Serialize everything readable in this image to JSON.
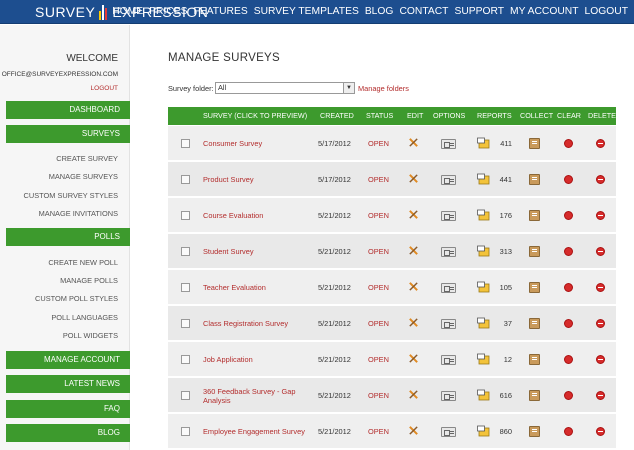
{
  "header": {
    "logo_left": "SURVEY",
    "logo_right": "EXPRESSION",
    "nav": [
      "HOME",
      "PRICES",
      "FEATURES",
      "SURVEY TEMPLATES",
      "BLOG",
      "CONTACT",
      "SUPPORT",
      "MY ACCOUNT",
      "LOGOUT"
    ]
  },
  "sidebar": {
    "welcome": "WELCOME",
    "email": "OFFICE@SURVEYEXPRESSION.COM",
    "logout": "LOGOUT",
    "dashboard": "DASHBOARD",
    "surveys": "SURVEYS",
    "survey_links": [
      "CREATE SURVEY",
      "MANAGE SURVEYS",
      "CUSTOM SURVEY STYLES",
      "MANAGE INVITATIONS"
    ],
    "polls": "POLLS",
    "poll_links": [
      "CREATE NEW POLL",
      "MANAGE POLLS",
      "CUSTOM POLL STYLES",
      "POLL LANGUAGES",
      "POLL WIDGETS"
    ],
    "manage_account": "MANAGE ACCOUNT",
    "latest_news": "LATEST NEWS",
    "faq": "FAQ",
    "blog": "BLOG"
  },
  "main": {
    "title": "MANAGE SURVEYS",
    "folder_label": "Survey folder:",
    "folder_value": "All",
    "manage_folders": "Manage folders",
    "columns": [
      "SURVEY (CLICK TO PREVIEW)",
      "CREATED",
      "STATUS",
      "EDIT",
      "OPTIONS",
      "REPORTS",
      "COLLECT",
      "CLEAR",
      "DELETE"
    ],
    "rows": [
      {
        "name": "Consumer Survey",
        "created": "5/17/2012",
        "status": "OPEN",
        "reports": "411"
      },
      {
        "name": "Product Survey",
        "created": "5/17/2012",
        "status": "OPEN",
        "reports": "441"
      },
      {
        "name": "Course Evaluation",
        "created": "5/21/2012",
        "status": "OPEN",
        "reports": "176"
      },
      {
        "name": "Student Survey",
        "created": "5/21/2012",
        "status": "OPEN",
        "reports": "313"
      },
      {
        "name": "Teacher Evaluation",
        "created": "5/21/2012",
        "status": "OPEN",
        "reports": "105"
      },
      {
        "name": "Class Registration Survey",
        "created": "5/21/2012",
        "status": "OPEN",
        "reports": "37"
      },
      {
        "name": "Job Application",
        "created": "5/21/2012",
        "status": "OPEN",
        "reports": "12"
      },
      {
        "name": "360 Feedback Survey - Gap Analysis",
        "created": "5/21/2012",
        "status": "OPEN",
        "reports": "616"
      },
      {
        "name": "Employee Engagement Survey",
        "created": "5/21/2012",
        "status": "OPEN",
        "reports": "860"
      }
    ]
  },
  "colors": {
    "header_blue": "#1d4e8f",
    "green": "#3d9a2d",
    "link_red": "#b32d2d"
  }
}
